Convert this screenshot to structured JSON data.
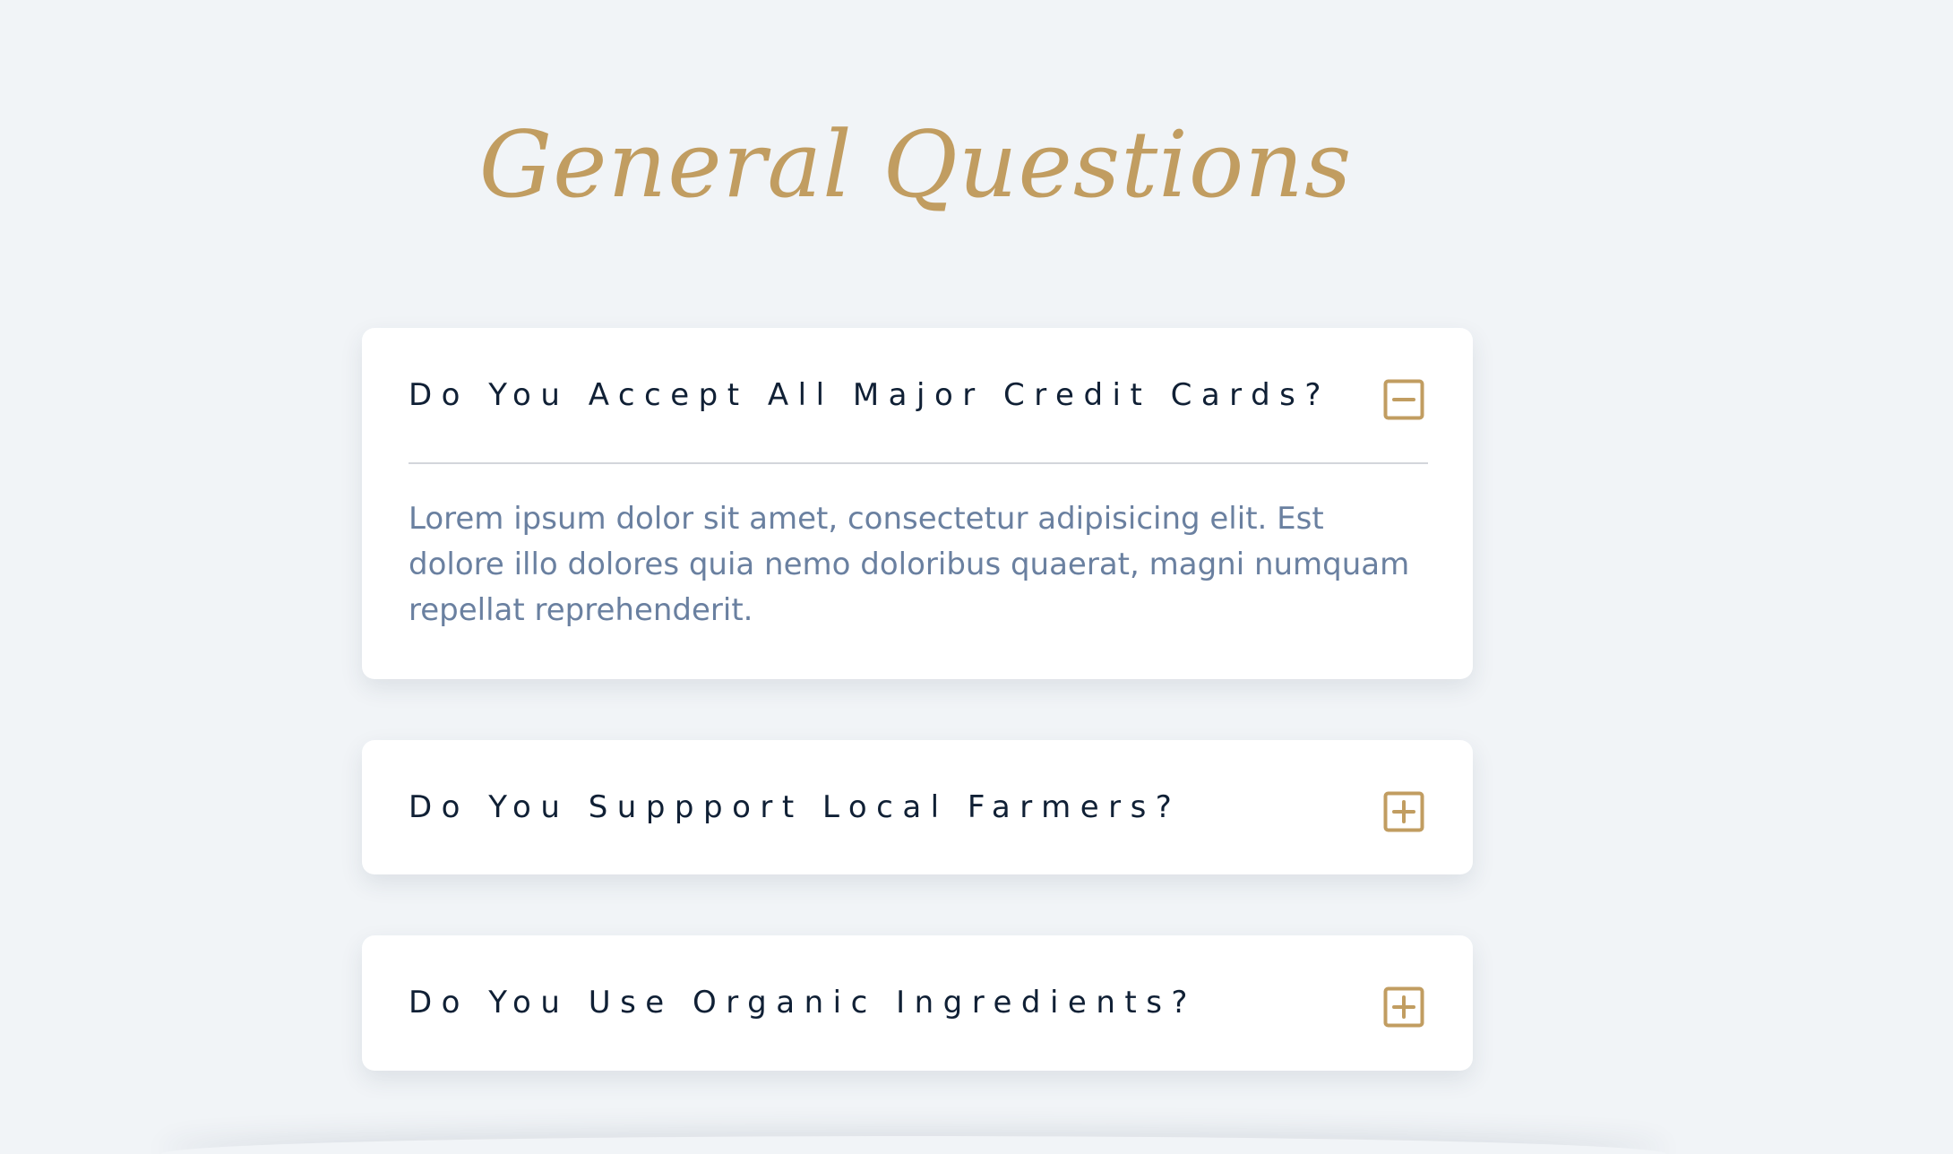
{
  "page": {
    "title": "General Questions"
  },
  "colors": {
    "background": "#f1f4f7",
    "accent_gold": "#c19d61",
    "question_text": "#102035",
    "answer_text": "#6a80a0",
    "divider": "#d3d6db"
  },
  "faq": [
    {
      "question": "Do You Accept All Major Credit Cards?",
      "expanded": true,
      "toggle_icon": "minus-square-icon",
      "answer": "Lorem ipsum dolor sit amet, consectetur adipisicing elit. Est dolore illo dolores quia nemo doloribus quaerat, magni numquam repellat reprehenderit."
    },
    {
      "question": "Do You Suppport Local Farmers?",
      "expanded": false,
      "toggle_icon": "plus-square-icon"
    },
    {
      "question": "Do You Use Organic Ingredients?",
      "expanded": false,
      "toggle_icon": "plus-square-icon"
    }
  ]
}
